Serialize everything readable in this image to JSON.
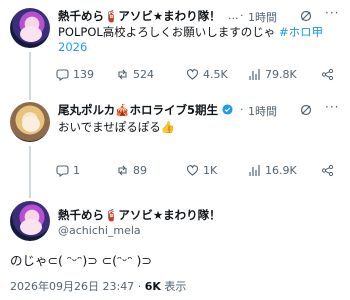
{
  "post1": {
    "name": "熱千めら🧯アソビ★まわり隊！",
    "ellipsis": "...",
    "separator": "·",
    "time": "1時間",
    "text": "POLPOL高校よろしくお願いしますのじゃ ",
    "hashtag": "#ホロ甲2026",
    "replies": "139",
    "reposts": "524",
    "likes": "4.5K",
    "views": "79.8K"
  },
  "post2": {
    "name": "尾丸ポルカ🎪ホロライブ5期生",
    "separator": "·",
    "time": "1時間",
    "text": "おいでませぽるぽる👍",
    "replies": "1",
    "reposts": "89",
    "likes": "1K",
    "views": "16.9K"
  },
  "post3": {
    "name": "熱千めら🧯アソビ★まわり隊！",
    "handle": "@achichi_mela",
    "text": "のじゃ⊂( ᵔᵕᵔ)⊃ ⊂(ᵔᵕᵔ )⊃",
    "datetime": "2026年09月26日 23:47",
    "dot": "·",
    "views_count": "6K",
    "views_label": "表示"
  },
  "icons": [
    "grok-icon",
    "more-icon",
    "reply-icon",
    "repost-icon",
    "like-icon",
    "views-icon",
    "share-icon",
    "verified-icon"
  ],
  "colors": {
    "accent": "#1d9bf0",
    "muted": "#536471",
    "text": "#0f1419"
  }
}
